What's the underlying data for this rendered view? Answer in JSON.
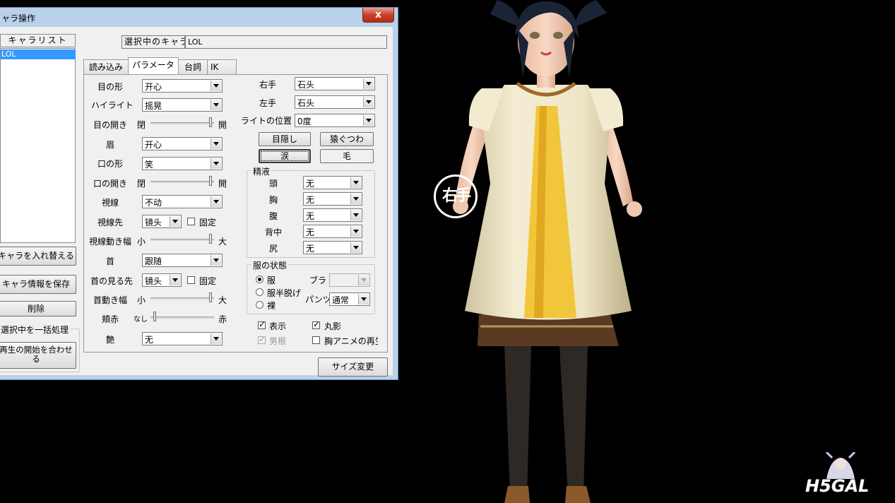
{
  "window": {
    "title": "ャラ操作",
    "close_glyph": "x"
  },
  "left_panel": {
    "list_header": "キャラリスト",
    "list_items": [
      "LOL"
    ],
    "replace_button": "キャラを入れ替える",
    "save_button": "キャラ情報を保存",
    "delete_button": "削除",
    "batch_group_label": "選択中を一括処理",
    "sync_playback_button": "再生の開始を合わせる"
  },
  "selected_char": {
    "label": "選択中のキャラ",
    "value": "LOL"
  },
  "tabs": [
    {
      "label": "読み込み",
      "selected": false
    },
    {
      "label": "パラメータ",
      "selected": true
    },
    {
      "label": "台詞",
      "selected": false
    },
    {
      "label": "IK",
      "selected": false
    }
  ],
  "params": {
    "eye_shape": {
      "label": "目の形",
      "value": "开心"
    },
    "highlight": {
      "label": "ハイライト",
      "value": "摇晃"
    },
    "eye_open": {
      "label": "目の開き",
      "min": "閉",
      "max": "開",
      "level": 0.97
    },
    "eyebrow": {
      "label": "眉",
      "value": "开心"
    },
    "mouth_shape": {
      "label": "口の形",
      "value": "笑"
    },
    "mouth_open": {
      "label": "口の開き",
      "min": "閉",
      "max": "開",
      "level": 0.97
    },
    "gaze": {
      "label": "視線",
      "value": "不动"
    },
    "gaze_target": {
      "label": "視線先",
      "value": "镜头",
      "fix_label": "固定",
      "fixed": false
    },
    "gaze_range": {
      "label": "視線動き幅",
      "min": "小",
      "max": "大",
      "level": 0.97
    },
    "neck": {
      "label": "首",
      "value": "跟随"
    },
    "neck_target": {
      "label": "首の見る先",
      "value": "镜头",
      "fix_label": "固定",
      "fixed": false
    },
    "neck_range": {
      "label": "首動き幅",
      "min": "小",
      "max": "大",
      "level": 0.97
    },
    "blush": {
      "label": "頬赤",
      "min": "なし",
      "max": "赤",
      "level": 0.05
    },
    "gloss": {
      "label": "艶",
      "value": "无"
    }
  },
  "right": {
    "right_hand": {
      "label": "右手",
      "value": "石头"
    },
    "left_hand": {
      "label": "左手",
      "value": "石头"
    },
    "light_pos": {
      "label": "ライトの位置",
      "value": "0度"
    },
    "blindfold_button": "目隠し",
    "gag_button": "猿ぐつわ",
    "tears_button": "涙",
    "hair_button": "毛",
    "fluid_group": "精液",
    "fluids": [
      {
        "label": "頭",
        "value": "无"
      },
      {
        "label": "胸",
        "value": "无"
      },
      {
        "label": "腹",
        "value": "无"
      },
      {
        "label": "背中",
        "value": "无"
      },
      {
        "label": "尻",
        "value": "无"
      }
    ],
    "clothes_group": "服の状態",
    "clothes_options": [
      {
        "label": "服",
        "selected": true
      },
      {
        "label": "服半脱げ",
        "selected": false
      },
      {
        "label": "裸",
        "selected": false
      }
    ],
    "bra_label": "ブラ",
    "bra_value": "",
    "pants_label": "パンツ",
    "pants_value": "通常",
    "show_label": "表示",
    "show_checked": true,
    "shadow_label": "丸影",
    "shadow_checked": true,
    "male_label": "男根",
    "male_checked": true,
    "chest_anim_label": "胸アニメの再生",
    "chest_anim_checked": false,
    "resize_button": "サイズ変更"
  },
  "viewport": {
    "hand_marker": "右手",
    "watermark": "H5GAL"
  }
}
